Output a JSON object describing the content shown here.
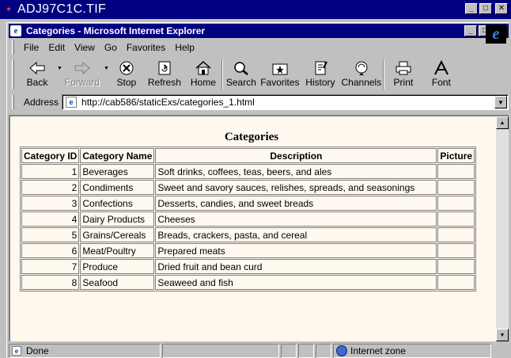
{
  "viewer": {
    "title": "ADJ97C1C.TIF"
  },
  "browser": {
    "title": "Categories - Microsoft Internet Explorer",
    "menu": [
      "File",
      "Edit",
      "View",
      "Go",
      "Favorites",
      "Help"
    ],
    "toolbar": {
      "back": "Back",
      "forward": "Forward",
      "stop": "Stop",
      "refresh": "Refresh",
      "home": "Home",
      "search": "Search",
      "favorites": "Favorites",
      "history": "History",
      "channels": "Channels",
      "print": "Print",
      "font": "Font"
    },
    "address_label": "Address",
    "url": "http://cab586/staticExs/categories_1.html",
    "status": {
      "text": "Done",
      "zone": "Internet zone"
    }
  },
  "page": {
    "heading": "Categories",
    "columns": [
      "Category ID",
      "Category Name",
      "Description",
      "Picture"
    ],
    "rows": [
      {
        "id": "1",
        "name": "Beverages",
        "description": "Soft drinks, coffees, teas, beers, and ales",
        "picture": ""
      },
      {
        "id": "2",
        "name": "Condiments",
        "description": "Sweet and savory sauces, relishes, spreads, and seasonings",
        "picture": ""
      },
      {
        "id": "3",
        "name": "Confections",
        "description": "Desserts, candies, and sweet breads",
        "picture": ""
      },
      {
        "id": "4",
        "name": "Dairy Products",
        "description": "Cheeses",
        "picture": ""
      },
      {
        "id": "5",
        "name": "Grains/Cereals",
        "description": "Breads, crackers, pasta, and cereal",
        "picture": ""
      },
      {
        "id": "6",
        "name": "Meat/Poultry",
        "description": "Prepared meats",
        "picture": ""
      },
      {
        "id": "7",
        "name": "Produce",
        "description": "Dried fruit and bean curd",
        "picture": ""
      },
      {
        "id": "8",
        "name": "Seafood",
        "description": "Seaweed and fish",
        "picture": ""
      }
    ]
  },
  "colors": {
    "titlebar": "#000080",
    "chrome": "#c0c0c0",
    "page_background": "#fff8ee"
  }
}
